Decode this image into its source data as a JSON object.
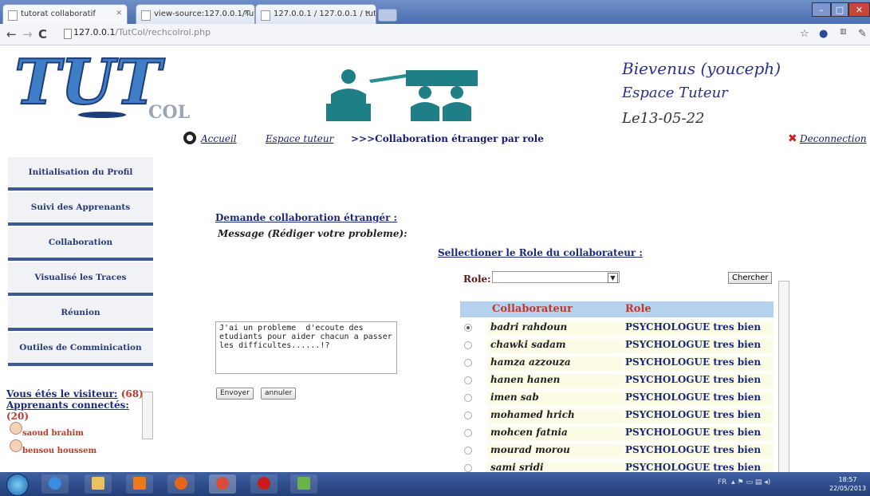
{
  "browser": {
    "tabs": [
      {
        "label": "tutorat collaboratif"
      },
      {
        "label": "view-source:127.0.0.1/Tut"
      },
      {
        "label": "127.0.0.1 / 127.0.0.1 / tutco"
      }
    ],
    "address": {
      "host": "127.0.0.1",
      "path": "/TutCol/rechcolrol.php"
    }
  },
  "header": {
    "welcome": "Bievenus (youceph)",
    "space": "Espace Tuteur",
    "date": "Le13-05-22"
  },
  "nav": {
    "home": "Accueil",
    "space": "Espace tuteur",
    "crumb": ">>>Collaboration étranger par role",
    "logout": "Deconnection"
  },
  "sidebar": {
    "items": [
      {
        "label": "Initialisation du Profil"
      },
      {
        "label": "Suivi des Apprenants"
      },
      {
        "label": "Collaboration"
      },
      {
        "label": "Visualisé les Traces"
      },
      {
        "label": "Réunion"
      },
      {
        "label": "Outiles de Comminication"
      }
    ],
    "visitor_label": "Vous étés le visiteur:",
    "visitor_count": "(68)",
    "connected_label": "Apprenants connectés:",
    "connected_count": "(20)",
    "users": [
      "saoud brahim",
      "bensou houssem"
    ]
  },
  "form": {
    "title": "Demande collaboration étrangér :",
    "message_label": "Message (Rédiger votre probleme):",
    "message_value": "J'ai un probleme  d'ecoute des etudiants pour aider chacun a passer les difficultes......!?",
    "send": "Envoyer",
    "cancel": "annuler"
  },
  "role_search": {
    "title": "Sellectioner le Role du collaborateur :",
    "role_label": "Role:",
    "role_value": "",
    "search": "Chercher",
    "columns": [
      "Collaborateur",
      "Role"
    ],
    "rows": [
      {
        "name": "badri rahdoun",
        "role": "PSYCHOLOGUE tres bien",
        "checked": true
      },
      {
        "name": "chawki sadam",
        "role": "PSYCHOLOGUE tres bien",
        "checked": false
      },
      {
        "name": "hamza azzouza",
        "role": "PSYCHOLOGUE tres bien",
        "checked": false
      },
      {
        "name": "hanen hanen",
        "role": "PSYCHOLOGUE tres bien",
        "checked": false
      },
      {
        "name": "imen sab",
        "role": "PSYCHOLOGUE tres bien",
        "checked": false
      },
      {
        "name": "mohamed hrich",
        "role": "PSYCHOLOGUE tres bien",
        "checked": false
      },
      {
        "name": "mohcen fatnia",
        "role": "PSYCHOLOGUE tres bien",
        "checked": false
      },
      {
        "name": "mourad morou",
        "role": "PSYCHOLOGUE tres bien",
        "checked": false
      },
      {
        "name": "sami sridi",
        "role": "PSYCHOLOGUE tres bien",
        "checked": false
      }
    ]
  },
  "taskbar": {
    "tray_lang": "FR",
    "clock_time": "18:57",
    "clock_date": "22/05/2013"
  },
  "colors": {
    "accent": "#263b78",
    "link": "#1a2a80",
    "danger": "#c0392b",
    "header_row": "#b4d2ee"
  }
}
